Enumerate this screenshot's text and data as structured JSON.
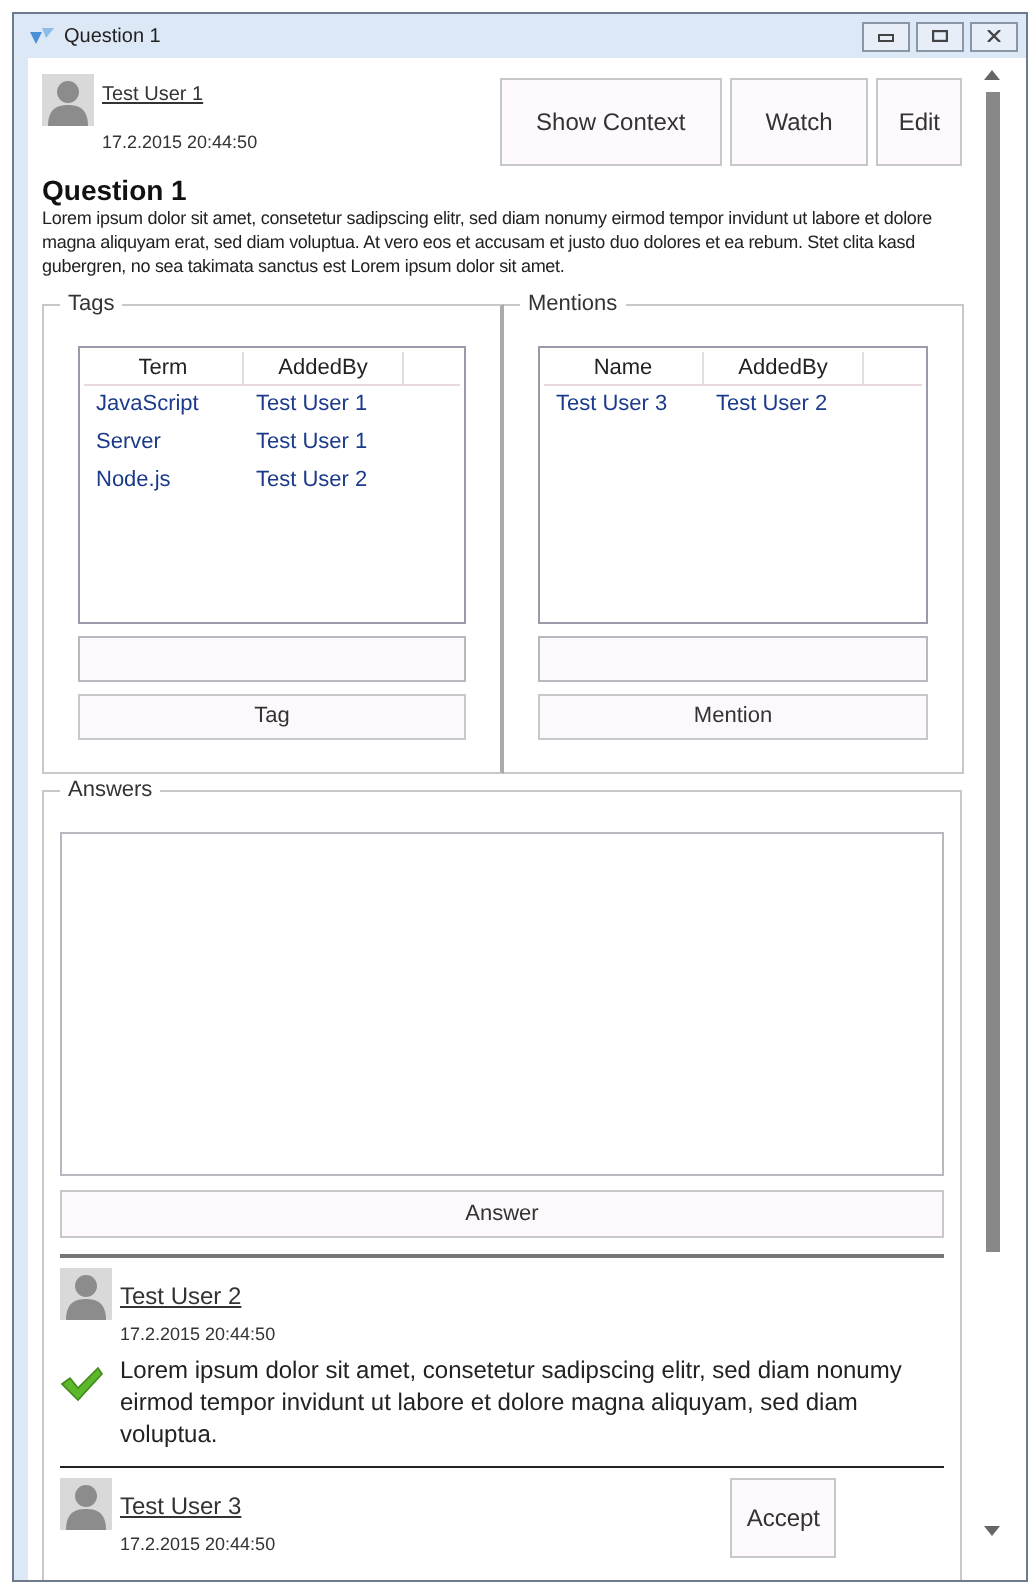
{
  "window": {
    "title": "Question 1"
  },
  "author": {
    "name": "Test User 1",
    "date": "17.2.2015 20:44:50"
  },
  "actions": [
    "Show Context",
    "Watch",
    "Edit"
  ],
  "question": {
    "title": "Question 1",
    "body": "Lorem ipsum dolor sit amet, consetetur sadipscing elitr, sed diam nonumy eirmod tempor invidunt ut labore et dolore magna aliquyam erat, sed diam voluptua. At vero eos et accusam et justo duo dolores et ea rebum. Stet clita kasd gubergren, no sea takimata sanctus est Lorem ipsum dolor sit amet."
  },
  "tags": {
    "title": "Tags",
    "columns": [
      "Term",
      "AddedBy"
    ],
    "rows": [
      [
        "JavaScript",
        "Test User 1"
      ],
      [
        "Server",
        "Test User 1"
      ],
      [
        "Node.js",
        "Test User 2"
      ]
    ],
    "button": "Tag"
  },
  "mentions": {
    "title": "Mentions",
    "columns": [
      "Name",
      "AddedBy"
    ],
    "rows": [
      [
        "Test User 3",
        "Test User 2"
      ]
    ],
    "button": "Mention"
  },
  "answers": {
    "title": "Answers",
    "button": "Answer",
    "items": [
      {
        "author": "Test User 2",
        "date": "17.2.2015 20:44:50",
        "accepted": true,
        "body": "Lorem ipsum dolor sit amet, consetetur sadipscing elitr, sed diam nonumy eirmod tempor invidunt ut labore et dolore magna aliquyam, sed diam voluptua."
      },
      {
        "author": "Test User 3",
        "date": "17.2.2015 20:44:50",
        "accepted": false,
        "accept_button": "Accept"
      }
    ]
  }
}
